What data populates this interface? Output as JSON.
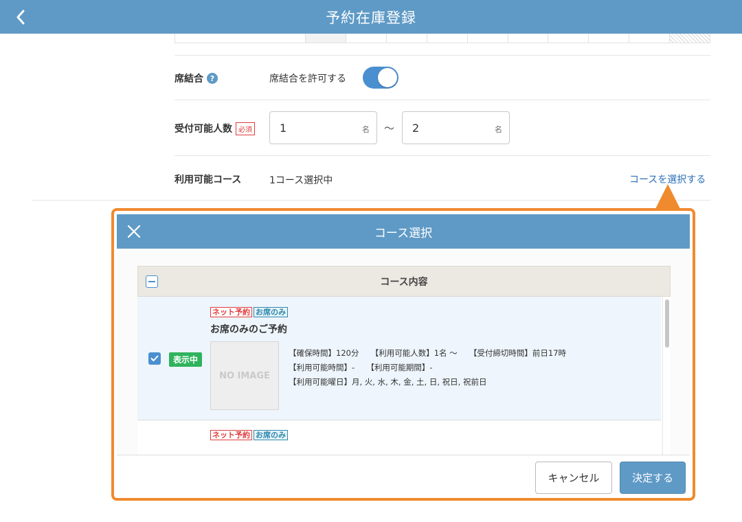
{
  "header": {
    "title": "予約在庫登録"
  },
  "form": {
    "seat_join": {
      "label": "席結合",
      "help": "?",
      "text": "席結合を許可する",
      "enabled": true
    },
    "capacity": {
      "label": "受付可能人数",
      "required": "必須",
      "min": "1",
      "max": "2",
      "unit": "名",
      "separator": "〜"
    },
    "course": {
      "label": "利用可能コース",
      "status": "1コース選択中",
      "link": "コースを選択する"
    }
  },
  "modal": {
    "title": "コース選択",
    "column_header": "コース内容",
    "courses": [
      {
        "tags": [
          "ネット予約",
          "お席のみ"
        ],
        "name": "お席のみのご予約",
        "status": "表示中",
        "image_placeholder": "NO IMAGE",
        "details": [
          "【確保時間】120分　　【利用可能人数】1名 〜　　【受付締切時間】前日17時",
          "【利用可能時間】-　　【利用可能期間】-",
          "【利用可能曜日】月, 火, 水, 木, 金, 土, 日, 祝日, 祝前日"
        ],
        "checked": true
      },
      {
        "tags": [
          "ネット予約",
          "お席のみ"
        ]
      }
    ],
    "cancel_label": "キャンセル",
    "ok_label": "決定する"
  },
  "colors": {
    "header": "#5f9ac6",
    "accent": "#f08a2e",
    "toggle": "#4a8fd0",
    "status": "#2fb35d",
    "link": "#2c6fb6"
  }
}
